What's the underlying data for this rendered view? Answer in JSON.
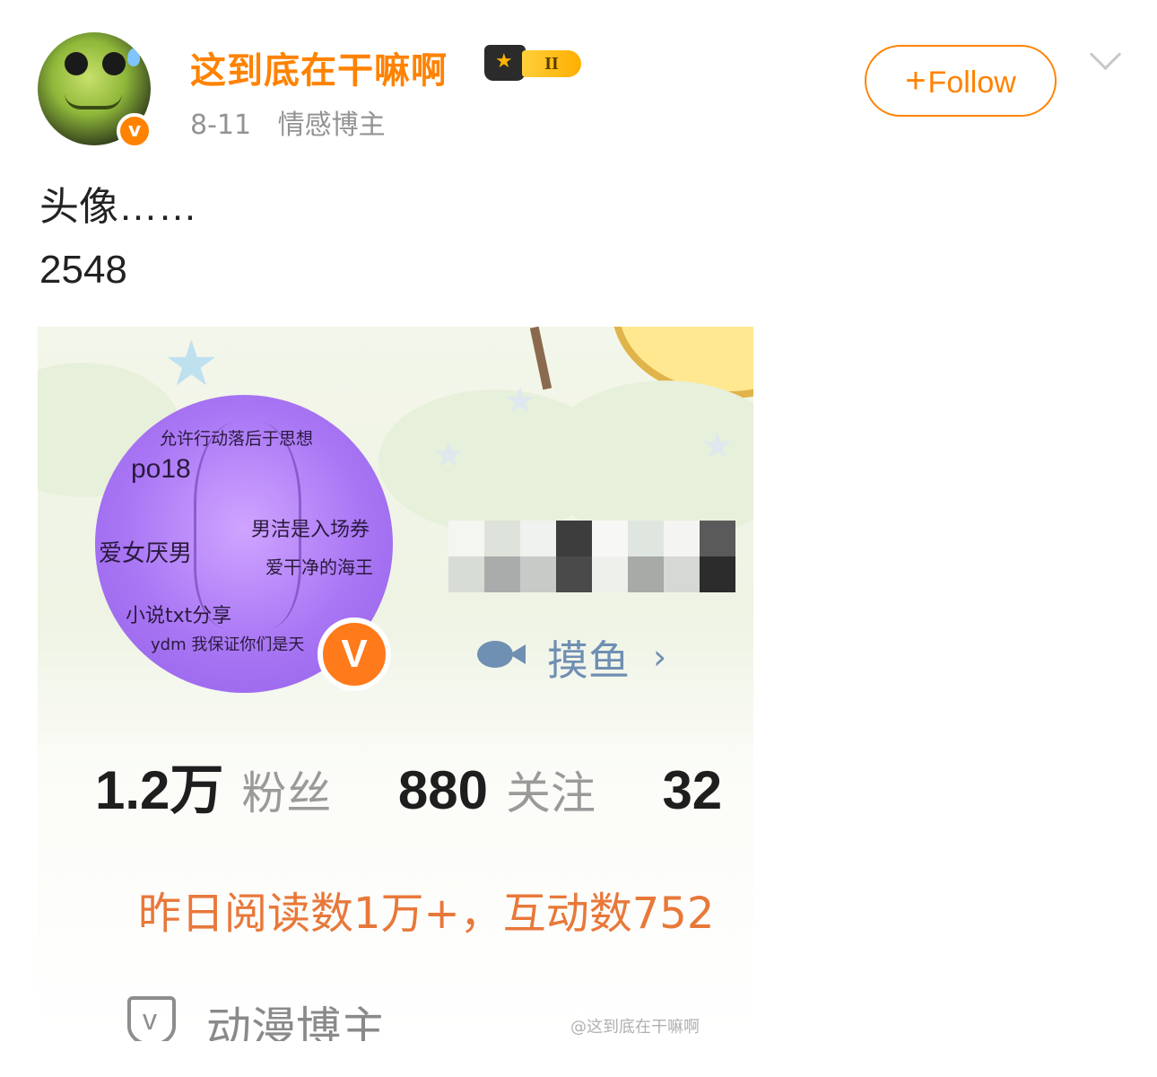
{
  "post": {
    "author": {
      "name": "这到底在干嘛啊",
      "level_badge": "II"
    },
    "meta": {
      "date": "8-11",
      "source": "情感博主"
    },
    "follow_label": "Follow",
    "text_lines": [
      "头像……",
      "2548"
    ]
  },
  "embedded_profile": {
    "avatar_texts": [
      "允许行动落后于思想",
      "po18",
      "男洁是入场券",
      "爱女厌男",
      "爱干净的海王",
      "小说txt分享",
      "ydm 我保证你们是天"
    ],
    "tag_label": "摸鱼",
    "stats": [
      {
        "value": "1.2万",
        "label": "粉丝"
      },
      {
        "value": "880",
        "label": "关注"
      },
      {
        "value": "32",
        "label": ""
      }
    ],
    "read_line": "昨日阅读数1万+，互动数752",
    "category_label": "动漫博主"
  },
  "watermark": "@这到底在干嘛啊",
  "colors": {
    "accent": "#ff8200",
    "muted": "#939393",
    "link_blue": "#6f8fb3",
    "read_orange": "#e8783a"
  }
}
